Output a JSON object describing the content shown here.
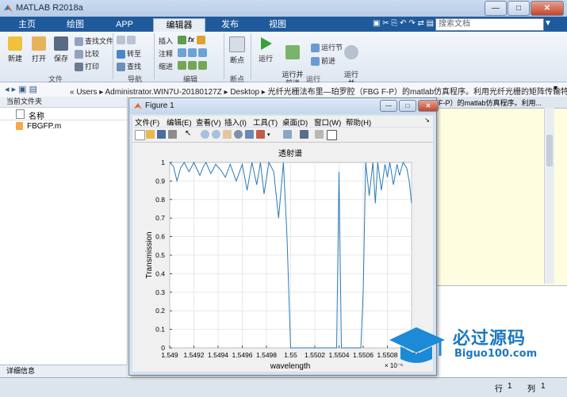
{
  "window": {
    "title": "MATLAB R2018a"
  },
  "tabs": [
    {
      "label": "主页"
    },
    {
      "label": "绘图"
    },
    {
      "label": "APP"
    },
    {
      "label": "编辑器"
    },
    {
      "label": "发布"
    },
    {
      "label": "视图"
    }
  ],
  "search": {
    "placeholder": "搜索文档"
  },
  "toolstrip": {
    "file": {
      "new": "新建",
      "open": "打开",
      "save": "保存",
      "find_files": "查找文件",
      "compare": "比较",
      "print": "打印",
      "group": "文件"
    },
    "nav": {
      "goto": "转至",
      "find": "查找",
      "group": "导航"
    },
    "edit": {
      "insert": "插入",
      "comment": "注释",
      "indent": "缩进",
      "fx": "fx",
      "group": "编辑"
    },
    "breakpoint": {
      "label": "断点",
      "group": "断点"
    },
    "run": {
      "run": "运行",
      "run_advance": "运行并\n前进",
      "run_section": "运行节",
      "advance": "前进",
      "run_time": "运行并\n计时",
      "group": "运行"
    }
  },
  "address": {
    "path": "« Users ▸ Administrator.WIN7U-20180127Z ▸ Desktop ▸ 光纤光栅法布里—珀罗腔（FBG F-P）的matlab仿真程序。利用光纤光栅的矩阵传输特性"
  },
  "left_panel": {
    "title": "当前文件夹",
    "column": "名称",
    "file": "FBGFP.m",
    "details": "详细信息"
  },
  "editor": {
    "tab_text": "F-P）的matlab仿真程序。利用..."
  },
  "status": {
    "row_label": "行",
    "row": "1",
    "col_label": "列",
    "col": "1"
  },
  "figure": {
    "title": "Figure 1",
    "menu": [
      "文件(F)",
      "编辑(E)",
      "查看(V)",
      "插入(I)",
      "工具(T)",
      "桌面(D)",
      "窗口(W)",
      "帮助(H)"
    ]
  },
  "chart_data": {
    "type": "line",
    "title": "透射谱",
    "xlabel": "wavelength",
    "ylabel": "Transmission",
    "x_exponent_label": "× 10⁻⁶",
    "xlim": [
      1.549,
      1.551
    ],
    "ylim": [
      0,
      1
    ],
    "xticks": [
      "1.549",
      "1.5492",
      "1.5494",
      "1.5496",
      "1.5498",
      "1.55",
      "1.5502",
      "1.5504",
      "1.5506",
      "1.5508",
      "1.551"
    ],
    "yticks": [
      "0",
      "0.1",
      "0.2",
      "0.3",
      "0.4",
      "0.5",
      "0.6",
      "0.7",
      "0.8",
      "0.9",
      "1"
    ],
    "grid": true,
    "series": [
      {
        "color": "#2a7ab8",
        "x": [
          1.549,
          1.54903,
          1.54906,
          1.54909,
          1.54912,
          1.54916,
          1.5492,
          1.54922,
          1.54925,
          1.54928,
          1.5493,
          1.54934,
          1.54938,
          1.54942,
          1.54946,
          1.5495,
          1.54955,
          1.5496,
          1.54964,
          1.54968,
          1.54972,
          1.54975,
          1.54978,
          1.54982,
          1.54986,
          1.5499,
          1.54994,
          1.54997,
          1.55,
          1.55003,
          1.55006,
          1.55009,
          1.55012,
          1.55015,
          1.55018,
          1.55021,
          1.55024,
          1.55027,
          1.5503,
          1.55034,
          1.55038,
          1.5504,
          1.55042,
          1.55044,
          1.55048,
          1.55052,
          1.55055,
          1.55058,
          1.5506,
          1.55062,
          1.55065,
          1.55068,
          1.5507,
          1.55072,
          1.55075,
          1.55078,
          1.5508,
          1.55082,
          1.55085,
          1.55088,
          1.5509,
          1.55093,
          1.55096,
          1.55098,
          1.551
        ],
        "y": [
          1.0,
          0.98,
          0.9,
          0.97,
          1.0,
          0.95,
          1.0,
          0.97,
          0.93,
          0.98,
          1.0,
          0.94,
          0.99,
          0.96,
          0.92,
          0.99,
          0.9,
          0.99,
          0.85,
          1.0,
          0.88,
          1.0,
          0.83,
          1.0,
          0.95,
          0.7,
          1.0,
          0.6,
          0.0,
          0.0,
          0.0,
          0.0,
          0.0,
          0.0,
          0.0,
          0.0,
          0.0,
          0.0,
          0.0,
          0.0,
          0.0,
          0.95,
          0.0,
          0.0,
          0.0,
          0.0,
          0.0,
          0.0,
          0.3,
          1.0,
          0.82,
          1.0,
          0.78,
          1.0,
          0.85,
          0.99,
          0.92,
          1.0,
          0.88,
          0.99,
          0.93,
          1.0,
          0.97,
          0.9,
          0.78
        ]
      }
    ]
  },
  "watermark": {
    "brand": "必过源码",
    "site": "Biguo100.com"
  }
}
